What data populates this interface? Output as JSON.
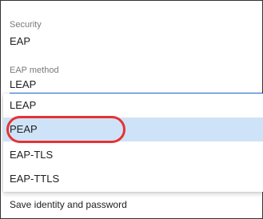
{
  "security": {
    "label": "Security",
    "value": "EAP"
  },
  "eap_method": {
    "label": "EAP method",
    "value": "LEAP"
  },
  "dropdown": {
    "options": [
      "LEAP",
      "PEAP",
      "EAP-TLS",
      "EAP-TTLS"
    ],
    "highlighted": "PEAP"
  },
  "save_identity_label": "Save identity and password",
  "colors": {
    "accent": "#1a73e8",
    "selected_bg": "#cfe3f8",
    "annotation": "#e53333"
  }
}
